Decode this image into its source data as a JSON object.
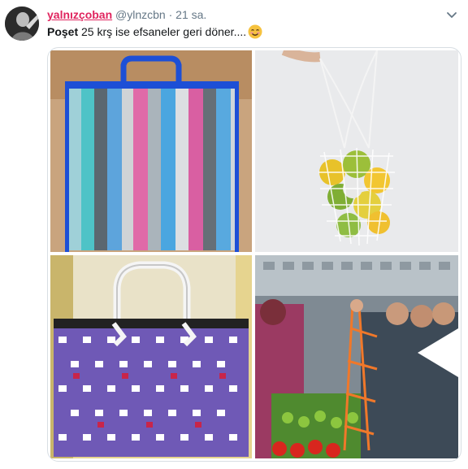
{
  "tweet": {
    "display_name": "yalnızçoban",
    "handle": "@ylnzcbn",
    "separator": "·",
    "time": "21 sa.",
    "text_bold": "Poşet",
    "text_rest": " 25 krş ise efsaneler geri döner....",
    "emoji_icon": "smiling-face-emoji"
  },
  "colors": {
    "name": "#e0245e",
    "secondary": "#657786"
  },
  "media": {
    "images": [
      {
        "icon": "striped-plastic-bag-photo"
      },
      {
        "icon": "string-net-bag-photo"
      },
      {
        "icon": "woven-plastic-basket-photo"
      },
      {
        "icon": "market-net-bag-photo"
      }
    ]
  }
}
